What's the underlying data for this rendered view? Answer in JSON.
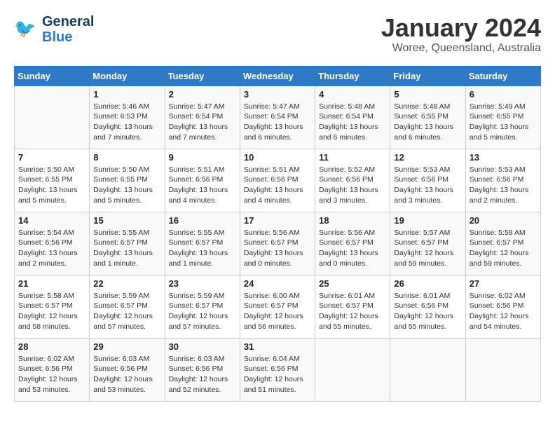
{
  "header": {
    "logo_general": "General",
    "logo_blue": "Blue",
    "month": "January 2024",
    "location": "Woree, Queensland, Australia"
  },
  "weekdays": [
    "Sunday",
    "Monday",
    "Tuesday",
    "Wednesday",
    "Thursday",
    "Friday",
    "Saturday"
  ],
  "weeks": [
    [
      {
        "day": "",
        "info": ""
      },
      {
        "day": "1",
        "info": "Sunrise: 5:46 AM\nSunset: 6:53 PM\nDaylight: 13 hours\nand 7 minutes."
      },
      {
        "day": "2",
        "info": "Sunrise: 5:47 AM\nSunset: 6:54 PM\nDaylight: 13 hours\nand 7 minutes."
      },
      {
        "day": "3",
        "info": "Sunrise: 5:47 AM\nSunset: 6:54 PM\nDaylight: 13 hours\nand 6 minutes."
      },
      {
        "day": "4",
        "info": "Sunrise: 5:48 AM\nSunset: 6:54 PM\nDaylight: 13 hours\nand 6 minutes."
      },
      {
        "day": "5",
        "info": "Sunrise: 5:48 AM\nSunset: 6:55 PM\nDaylight: 13 hours\nand 6 minutes."
      },
      {
        "day": "6",
        "info": "Sunrise: 5:49 AM\nSunset: 6:55 PM\nDaylight: 13 hours\nand 5 minutes."
      }
    ],
    [
      {
        "day": "7",
        "info": "Sunrise: 5:50 AM\nSunset: 6:55 PM\nDaylight: 13 hours\nand 5 minutes."
      },
      {
        "day": "8",
        "info": "Sunrise: 5:50 AM\nSunset: 6:55 PM\nDaylight: 13 hours\nand 5 minutes."
      },
      {
        "day": "9",
        "info": "Sunrise: 5:51 AM\nSunset: 6:56 PM\nDaylight: 13 hours\nand 4 minutes."
      },
      {
        "day": "10",
        "info": "Sunrise: 5:51 AM\nSunset: 6:56 PM\nDaylight: 13 hours\nand 4 minutes."
      },
      {
        "day": "11",
        "info": "Sunrise: 5:52 AM\nSunset: 6:56 PM\nDaylight: 13 hours\nand 3 minutes."
      },
      {
        "day": "12",
        "info": "Sunrise: 5:53 AM\nSunset: 6:56 PM\nDaylight: 13 hours\nand 3 minutes."
      },
      {
        "day": "13",
        "info": "Sunrise: 5:53 AM\nSunset: 6:56 PM\nDaylight: 13 hours\nand 2 minutes."
      }
    ],
    [
      {
        "day": "14",
        "info": "Sunrise: 5:54 AM\nSunset: 6:56 PM\nDaylight: 13 hours\nand 2 minutes."
      },
      {
        "day": "15",
        "info": "Sunrise: 5:55 AM\nSunset: 6:57 PM\nDaylight: 13 hours\nand 1 minute."
      },
      {
        "day": "16",
        "info": "Sunrise: 5:55 AM\nSunset: 6:57 PM\nDaylight: 13 hours\nand 1 minute."
      },
      {
        "day": "17",
        "info": "Sunrise: 5:56 AM\nSunset: 6:57 PM\nDaylight: 13 hours\nand 0 minutes."
      },
      {
        "day": "18",
        "info": "Sunrise: 5:56 AM\nSunset: 6:57 PM\nDaylight: 13 hours\nand 0 minutes."
      },
      {
        "day": "19",
        "info": "Sunrise: 5:57 AM\nSunset: 6:57 PM\nDaylight: 12 hours\nand 59 minutes."
      },
      {
        "day": "20",
        "info": "Sunrise: 5:58 AM\nSunset: 6:57 PM\nDaylight: 12 hours\nand 59 minutes."
      }
    ],
    [
      {
        "day": "21",
        "info": "Sunrise: 5:58 AM\nSunset: 6:57 PM\nDaylight: 12 hours\nand 58 minutes."
      },
      {
        "day": "22",
        "info": "Sunrise: 5:59 AM\nSunset: 6:57 PM\nDaylight: 12 hours\nand 57 minutes."
      },
      {
        "day": "23",
        "info": "Sunrise: 5:59 AM\nSunset: 6:57 PM\nDaylight: 12 hours\nand 57 minutes."
      },
      {
        "day": "24",
        "info": "Sunrise: 6:00 AM\nSunset: 6:57 PM\nDaylight: 12 hours\nand 56 minutes."
      },
      {
        "day": "25",
        "info": "Sunrise: 6:01 AM\nSunset: 6:57 PM\nDaylight: 12 hours\nand 55 minutes."
      },
      {
        "day": "26",
        "info": "Sunrise: 6:01 AM\nSunset: 6:56 PM\nDaylight: 12 hours\nand 55 minutes."
      },
      {
        "day": "27",
        "info": "Sunrise: 6:02 AM\nSunset: 6:56 PM\nDaylight: 12 hours\nand 54 minutes."
      }
    ],
    [
      {
        "day": "28",
        "info": "Sunrise: 6:02 AM\nSunset: 6:56 PM\nDaylight: 12 hours\nand 53 minutes."
      },
      {
        "day": "29",
        "info": "Sunrise: 6:03 AM\nSunset: 6:56 PM\nDaylight: 12 hours\nand 53 minutes."
      },
      {
        "day": "30",
        "info": "Sunrise: 6:03 AM\nSunset: 6:56 PM\nDaylight: 12 hours\nand 52 minutes."
      },
      {
        "day": "31",
        "info": "Sunrise: 6:04 AM\nSunset: 6:56 PM\nDaylight: 12 hours\nand 51 minutes."
      },
      {
        "day": "",
        "info": ""
      },
      {
        "day": "",
        "info": ""
      },
      {
        "day": "",
        "info": ""
      }
    ]
  ]
}
